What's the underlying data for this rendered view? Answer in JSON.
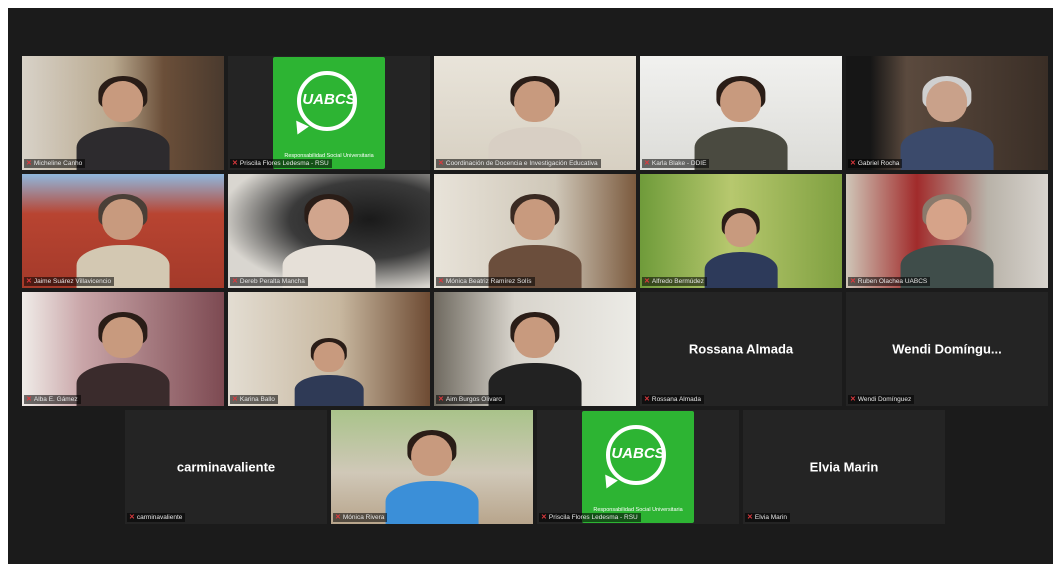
{
  "meeting": {
    "participants": [
      {
        "name": "Micheline Canho",
        "tile": "video"
      },
      {
        "name": "Priscila Flores Ledesma - RSU",
        "tile": "logo"
      },
      {
        "name": "Coordinación de Docencia e Investigación Educativa",
        "tile": "video"
      },
      {
        "name": "Karla Blake - DDIE",
        "tile": "video"
      },
      {
        "name": "Gabriel Rocha",
        "tile": "video"
      },
      {
        "name": "Jaime Suárez Villavicencio",
        "tile": "video"
      },
      {
        "name": "Dereb Peralta Mancha",
        "tile": "video"
      },
      {
        "name": "Mónica Beatriz Ramírez Solís",
        "tile": "video"
      },
      {
        "name": "Alfredo Bermúdez",
        "tile": "video"
      },
      {
        "name": "Ruben Olachea UABCS",
        "tile": "video"
      },
      {
        "name": "Alba E. Gámez",
        "tile": "video"
      },
      {
        "name": "Karina Ballo",
        "tile": "video"
      },
      {
        "name": "Aim Burgos Olivaro",
        "tile": "video",
        "active": true
      },
      {
        "name": "Rossana Almada",
        "display_name": "Rossana Almada",
        "tile": "name"
      },
      {
        "name": "Wendi Domínguez",
        "display_name": "Wendi Domíngu...",
        "tile": "name"
      },
      {
        "name": "carminavaliente",
        "display_name": "carminavaliente",
        "tile": "name"
      },
      {
        "name": "Mónica Rivera",
        "tile": "video"
      },
      {
        "name": "Priscila Flores Ledesma - RSU",
        "tile": "logo"
      },
      {
        "name": "Elvia Marin",
        "display_name": "Elvia Marin",
        "tile": "name"
      }
    ]
  },
  "logo": {
    "text": "UABCS",
    "caption": "Responsabilidad Social Universitaria",
    "color": "#2db433"
  },
  "icons": {
    "muted_mic": "mic-off-icon",
    "muted_color": "#e0393e"
  }
}
